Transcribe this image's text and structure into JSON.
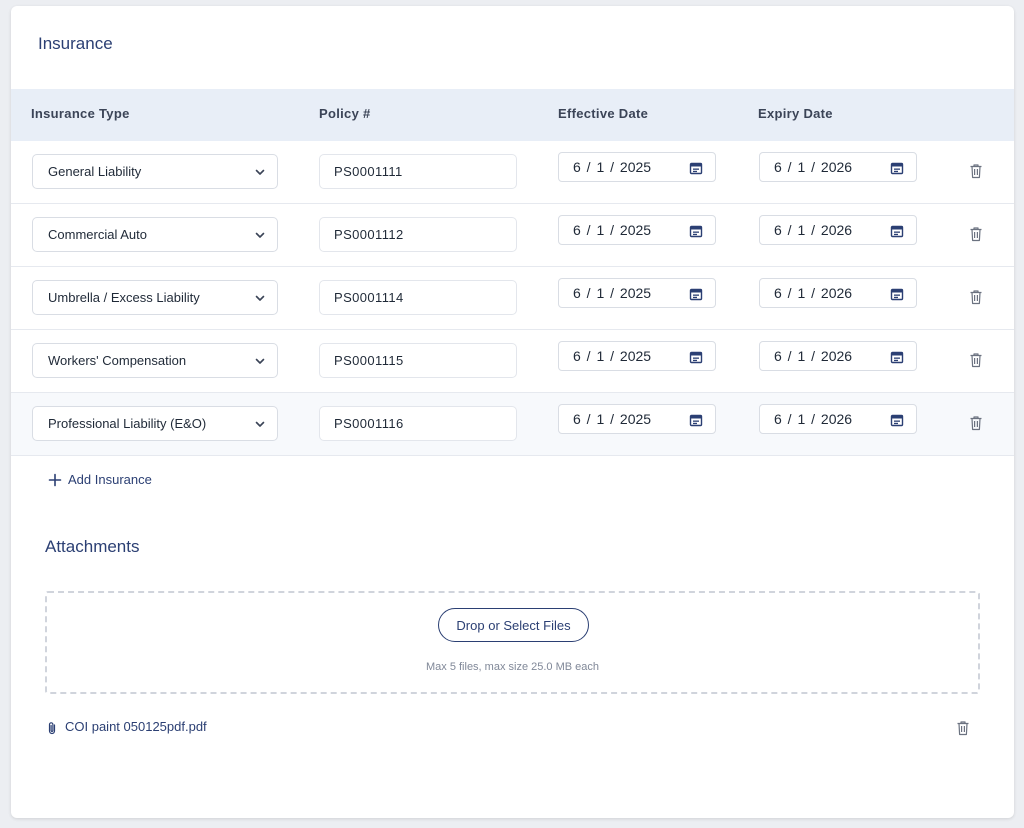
{
  "insurance": {
    "title": "Insurance",
    "columns": {
      "type": "Insurance Type",
      "policy": "Policy #",
      "effective": "Effective Date",
      "expiry": "Expiry Date"
    },
    "rows": [
      {
        "type": "General Liability",
        "policy": "PS0001111",
        "effective": "6 / 1 / 2025",
        "expiry": "6 / 1 / 2026"
      },
      {
        "type": "Commercial Auto",
        "policy": "PS0001112",
        "effective": "6 / 1 / 2025",
        "expiry": "6 / 1 / 2026"
      },
      {
        "type": "Umbrella / Excess Liability",
        "policy": "PS0001114",
        "effective": "6 / 1 / 2025",
        "expiry": "6 / 1 / 2026"
      },
      {
        "type": "Workers' Compensation",
        "policy": "PS0001115",
        "effective": "6 / 1 / 2025",
        "expiry": "6 / 1 / 2026"
      },
      {
        "type": "Professional Liability (E&O)",
        "policy": "PS0001116",
        "effective": "6 / 1 / 2025",
        "expiry": "6 / 1 / 2026"
      }
    ],
    "add_label": "Add Insurance"
  },
  "attachments": {
    "title": "Attachments",
    "drop_button": "Drop or Select Files",
    "hint": "Max 5 files, max size 25.0 MB each",
    "files": [
      {
        "name": "COI paint 050125pdf.pdf"
      }
    ]
  },
  "colors": {
    "accent": "#2b3f73",
    "header_bg": "#e8eef7",
    "page_bg": "#eceef2"
  },
  "icons": {
    "select": "chevron-down-icon",
    "date": "calendar-icon",
    "delete": "trash-icon",
    "add": "plus-icon",
    "file": "paperclip-icon"
  }
}
